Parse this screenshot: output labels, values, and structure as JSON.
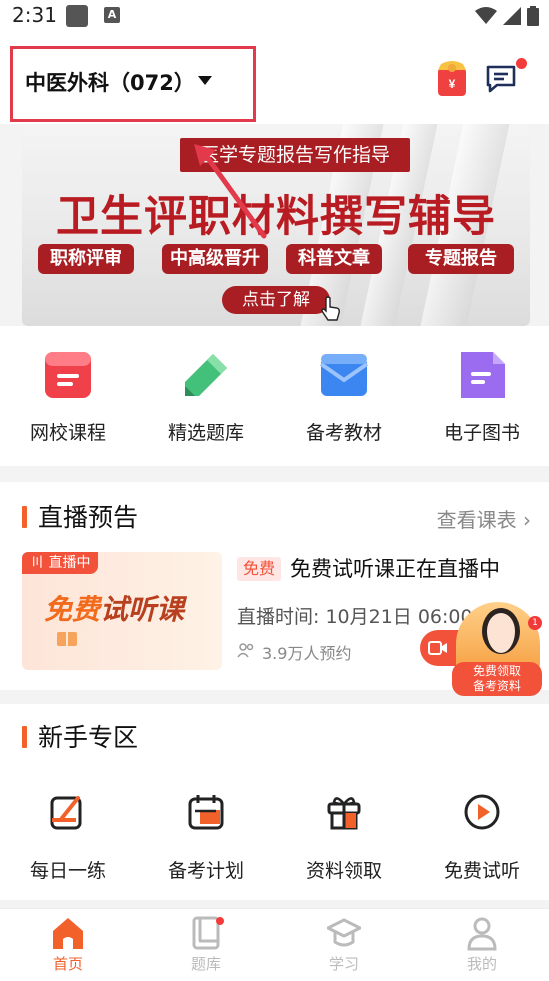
{
  "status_bar": {
    "time": "2:31",
    "icon_a": "A"
  },
  "header": {
    "course_title": "中医外科（072）"
  },
  "banner": {
    "tag": "医学专题报告写作指导",
    "headline": "卫生评职材料撰写辅导",
    "chips": [
      "职称评审",
      "中高级晋升",
      "科普文章",
      "专题报告"
    ],
    "cta": "点击了解"
  },
  "quick_nav": [
    {
      "label": "网校课程",
      "icon": "course-icon"
    },
    {
      "label": "精选题库",
      "icon": "pencil-icon"
    },
    {
      "label": "备考教材",
      "icon": "mail-book-icon"
    },
    {
      "label": "电子图书",
      "icon": "ebook-icon"
    }
  ],
  "live_section": {
    "title": "直播预告",
    "more": "查看课表",
    "badge": "直播中",
    "thumb_text_a": "免费",
    "thumb_text_b": "试听课",
    "free_tag": "免费",
    "item_title": "免费试听课正在直播中",
    "time": "直播时间: 10月21日 06:00",
    "count": "3.9万人预约"
  },
  "float_promo": {
    "badge": "1",
    "line1": "免费领取",
    "line2": "备考资料"
  },
  "newbie_section": {
    "title": "新手专区",
    "items": [
      {
        "label": "每日一练",
        "icon": "daily-practice-icon"
      },
      {
        "label": "备考计划",
        "icon": "calendar-icon"
      },
      {
        "label": "资料领取",
        "icon": "gift-icon"
      },
      {
        "label": "免费试听",
        "icon": "play-icon"
      }
    ]
  },
  "bottom_nav": [
    {
      "label": "首页",
      "icon": "home-icon",
      "active": true
    },
    {
      "label": "题库",
      "icon": "question-bank-icon",
      "active": false
    },
    {
      "label": "学习",
      "icon": "study-icon",
      "active": false
    },
    {
      "label": "我的",
      "icon": "profile-icon",
      "active": false
    }
  ],
  "colors": {
    "accent": "#f3612b",
    "banner_red": "#a81e23",
    "highlight_box": "#e23a4a",
    "live_red": "#f2523a"
  }
}
